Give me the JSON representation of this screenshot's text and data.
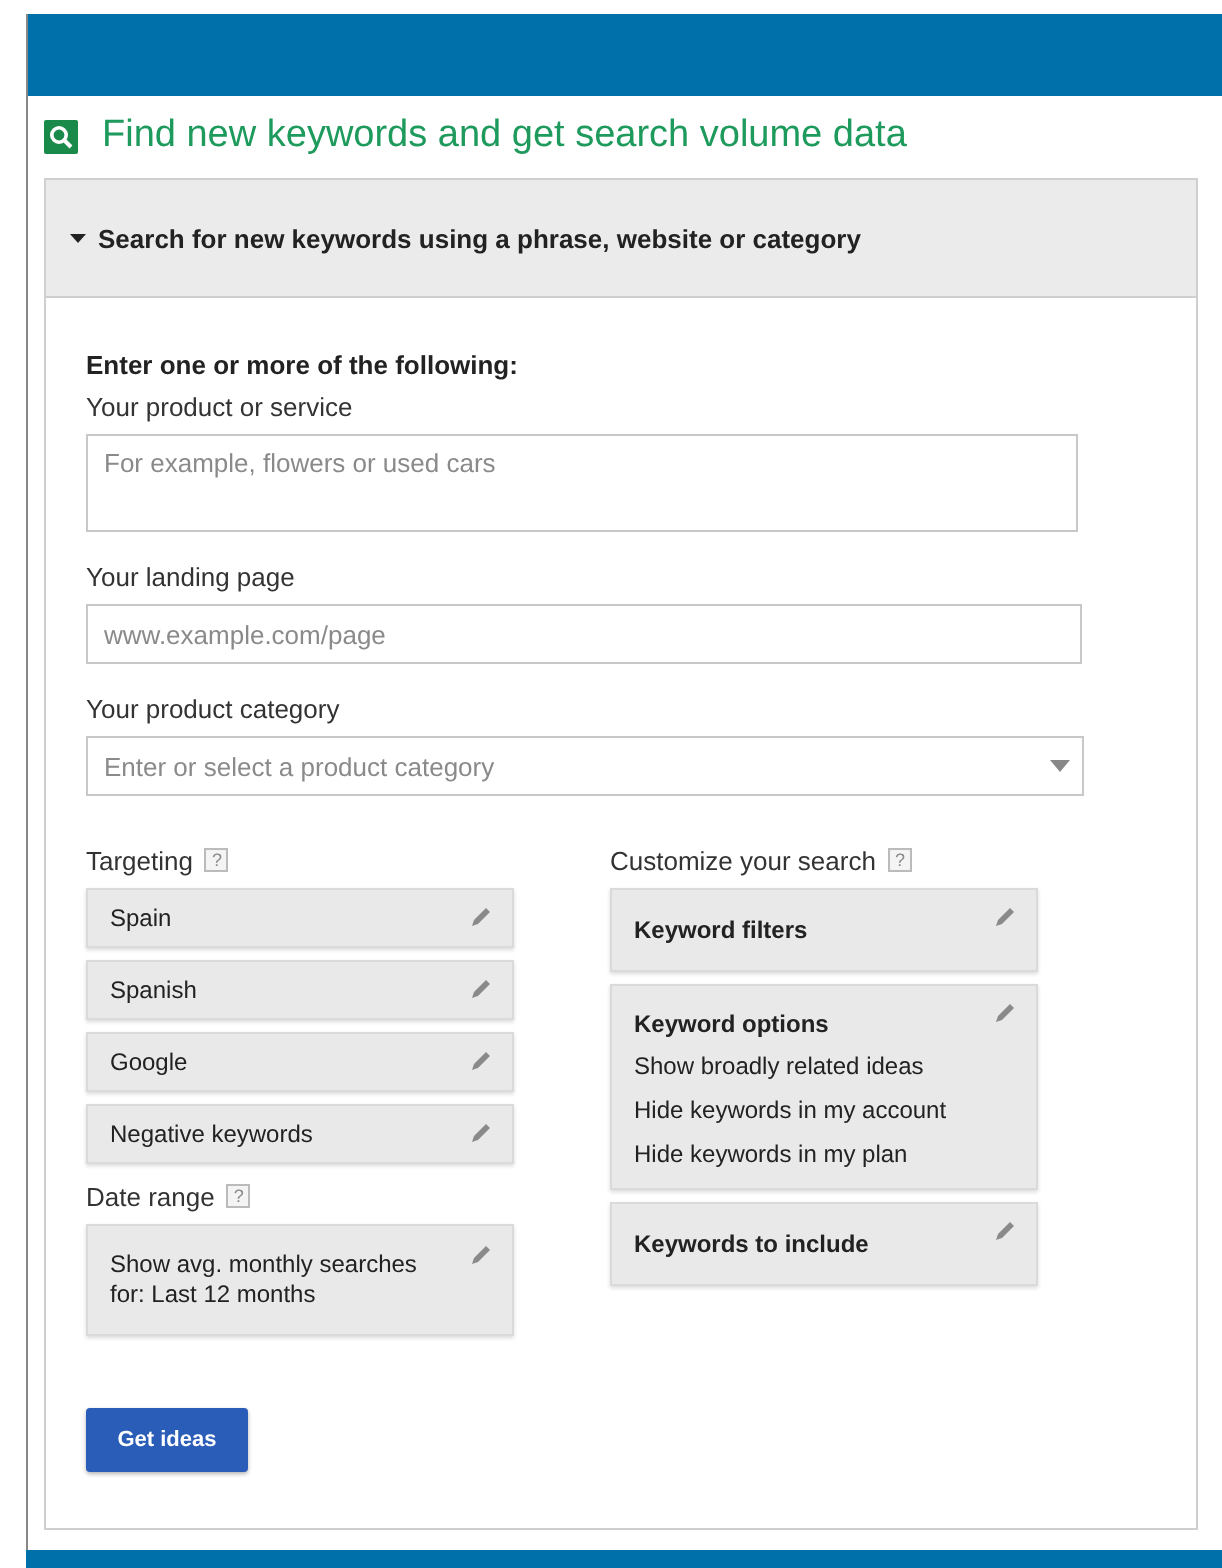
{
  "title": "Find new keywords and get search volume data",
  "section": {
    "title": "Search for new keywords using a phrase, website or category",
    "expanded": true
  },
  "intro": "Enter one or more of the following:",
  "fields": [
    {
      "kind": "textarea",
      "label": "Your product or service",
      "placeholder": "For example, flowers or used cars"
    },
    {
      "kind": "text",
      "label": "Your landing page",
      "placeholder": "www.example.com/page"
    },
    {
      "kind": "select",
      "label": "Your product category",
      "placeholder": "Enter or select a product category"
    }
  ],
  "targeting": {
    "label": "Targeting",
    "help": "?",
    "items": [
      "Spain",
      "Spanish",
      "Google",
      "Negative keywords"
    ]
  },
  "date_range": {
    "label": "Date range",
    "help": "?",
    "value": "Show avg. monthly searches for: Last 12 months"
  },
  "customize": {
    "label": "Customize your search",
    "help": "?",
    "items": [
      {
        "title": "Keyword filters"
      },
      {
        "title": "Keyword options",
        "lines": [
          "Show broadly related ideas",
          "Hide keywords in my account",
          "Hide keywords in my plan"
        ]
      },
      {
        "title": "Keywords to include"
      }
    ]
  },
  "button": "Get ideas"
}
